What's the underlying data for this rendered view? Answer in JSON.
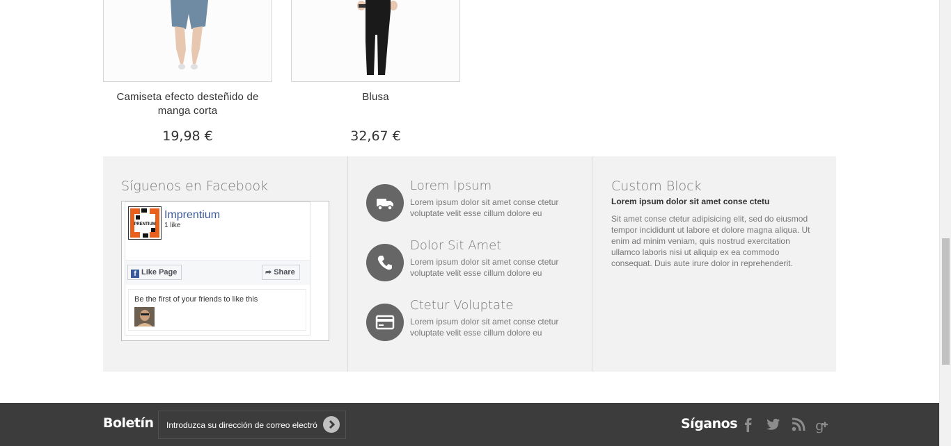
{
  "products": [
    {
      "name": "Camiseta efecto desteñido de manga corta",
      "price": "19,98 €"
    },
    {
      "name": "Blusa",
      "price": "32,67 €"
    }
  ],
  "facebook": {
    "title": "Síguenos en Facebook",
    "page_name": "Imprentium",
    "likes": "1 like",
    "like_button": "Like Page",
    "share_button": "Share",
    "friends_text": "Be the first of your friends to like this",
    "logo_text": "PRENTIUM"
  },
  "features": [
    {
      "title": "Lorem Ipsum",
      "text": "Lorem ipsum dolor sit amet conse ctetur voluptate velit esse cillum dolore eu",
      "icon": "truck-icon"
    },
    {
      "title": "Dolor Sit Amet",
      "text": "Lorem ipsum dolor sit amet conse ctetur voluptate velit esse cillum dolore eu",
      "icon": "phone-icon"
    },
    {
      "title": "Ctetur Voluptate",
      "text": "Lorem ipsum dolor sit amet conse ctetur voluptate velit esse cillum dolore eu",
      "icon": "credit-card-icon"
    }
  ],
  "custom_block": {
    "title": "Custom Block",
    "subtitle": "Lorem ipsum dolor sit amet conse ctetu",
    "text": "Sit amet conse ctetur adipisicing elit, sed do eiusmod tempor incididunt ut labore et dolore magna aliqua. Ut enim ad minim veniam, quis nostrud exercitation ullamco laboris nisi ut aliquip ex ea commodo consequat. Duis aute irure dolor in reprehenderit."
  },
  "footer": {
    "newsletter_title": "Boletín",
    "newsletter_value": "Introduzca su dirección de correo electrónico",
    "follow_title": "Síganos",
    "social": [
      "facebook-icon",
      "twitter-icon",
      "rss-icon",
      "google-plus-icon"
    ]
  },
  "colors": {
    "footer_bg": "#3c3c3c",
    "band_bg": "#f2f2f2",
    "icon_circle": "#666666",
    "facebook_blue": "#3b5998"
  }
}
